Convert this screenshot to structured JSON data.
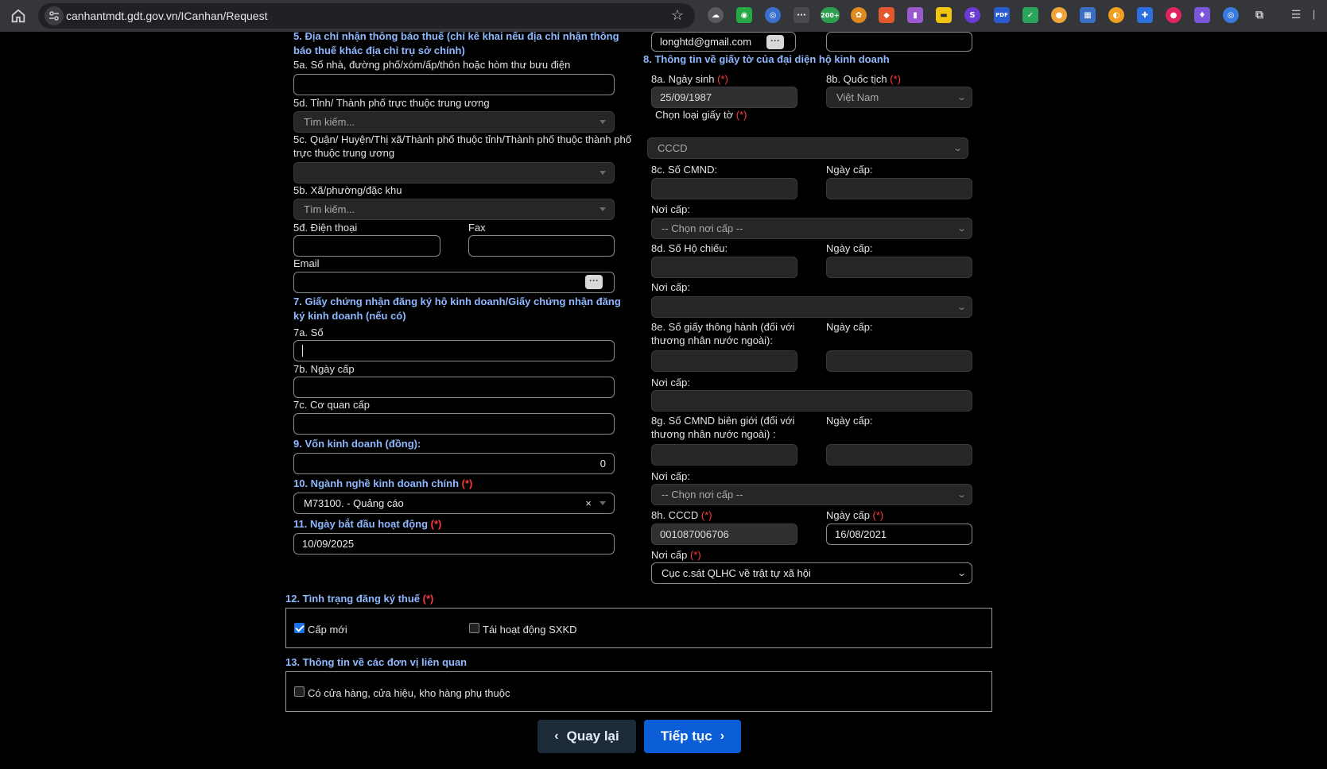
{
  "browser": {
    "url": "canhantmdt.gdt.gov.vn/ICanhan/Request",
    "ext_badge": "200+"
  },
  "left": {
    "s5_title": "5. Địa chỉ nhận thông báo thuế (chỉ kê khai nếu địa chỉ nhận thông báo thuế khác địa chỉ trụ sở chính)",
    "s5a_label": "5a. Số nhà, đường phố/xóm/ấp/thôn hoặc hòm thư bưu điện",
    "s5d_province_label": "5d. Tỉnh/ Thành phố trực thuộc trung ương",
    "s5d_province_placeholder": "Tìm kiếm...",
    "s5c_label": "5c. Quận/ Huyện/Thị xã/Thành phố thuộc tỉnh/Thành phố thuộc thành phố trực thuộc trung ương",
    "s5b_label": "5b. Xã/phường/đặc khu",
    "s5b_placeholder": "Tìm kiếm...",
    "phone_label": "5đ. Điện thoại",
    "fax_label": "Fax",
    "email_label": "Email",
    "s7_title": "7. Giấy chứng nhận đăng ký hộ kinh doanh/Giấy chứng nhận đăng ký kinh doanh (nếu có)",
    "s7a_label": "7a. Số",
    "s7b_label": "7b. Ngày cấp",
    "s7c_label": "7c. Cơ quan cấp",
    "s9_title": "9. Vốn kinh doanh (đồng):",
    "s9_value": "0",
    "s10_title": "10. Ngành nghề kinh doanh chính",
    "s10_value": "M73100. - Quảng cáo",
    "s10_clear": "×",
    "s11_title": "11. Ngày bắt đầu hoạt động",
    "s11_value": "10/09/2025",
    "req": "(*)"
  },
  "right": {
    "email_value": "longhtd@gmail.com",
    "s8_title": "8. Thông tin về giấy tờ của đại diện hộ kinh doanh",
    "dob_label": "8a. Ngày sinh",
    "dob_value": "25/09/1987",
    "nation_label": "8b. Quốc tịch",
    "nation_value": "Việt Nam",
    "doc_type_label": "Chọn loại giấy tờ",
    "doc_type_value": "CCCD",
    "cmnd_label": "8c. Số CMND:",
    "issue_date_label": "Ngày cấp:",
    "issue_place_label": "Nơi cấp:",
    "choose_place": "-- Chọn nơi cấp --",
    "passport_label": "8d. Số Hộ chiếu:",
    "s8e_label": "8e. Số giấy thông hành (đối với thương nhân nước ngoài):",
    "s8g_label": "8g. Số CMND biên giới (đối với thương nhân nước ngoài) :",
    "cccd_label": "8h. CCCD",
    "cccd_value": "001087006706",
    "cccd_date_label": "Ngày cấp",
    "cccd_date_value": "16/08/2021",
    "cccd_place_label": "Nơi cấp",
    "cccd_place_value": "Cục c.sát QLHC về trật tự xã hội"
  },
  "bottom": {
    "s12_title": "12. Tình trạng đăng ký thuế",
    "opt_new": "Cấp mới",
    "opt_new_checked": true,
    "opt_reactivate": "Tái hoạt động SXKD",
    "opt_reactivate_checked": false,
    "s13_title": "13. Thông tin về các đơn vị liên quan",
    "opt_stores": "Có cửa hàng, cửa hiệu, kho hàng phụ thuộc",
    "opt_stores_checked": false,
    "back_label": "Quay lại",
    "next_label": "Tiếp tục"
  }
}
